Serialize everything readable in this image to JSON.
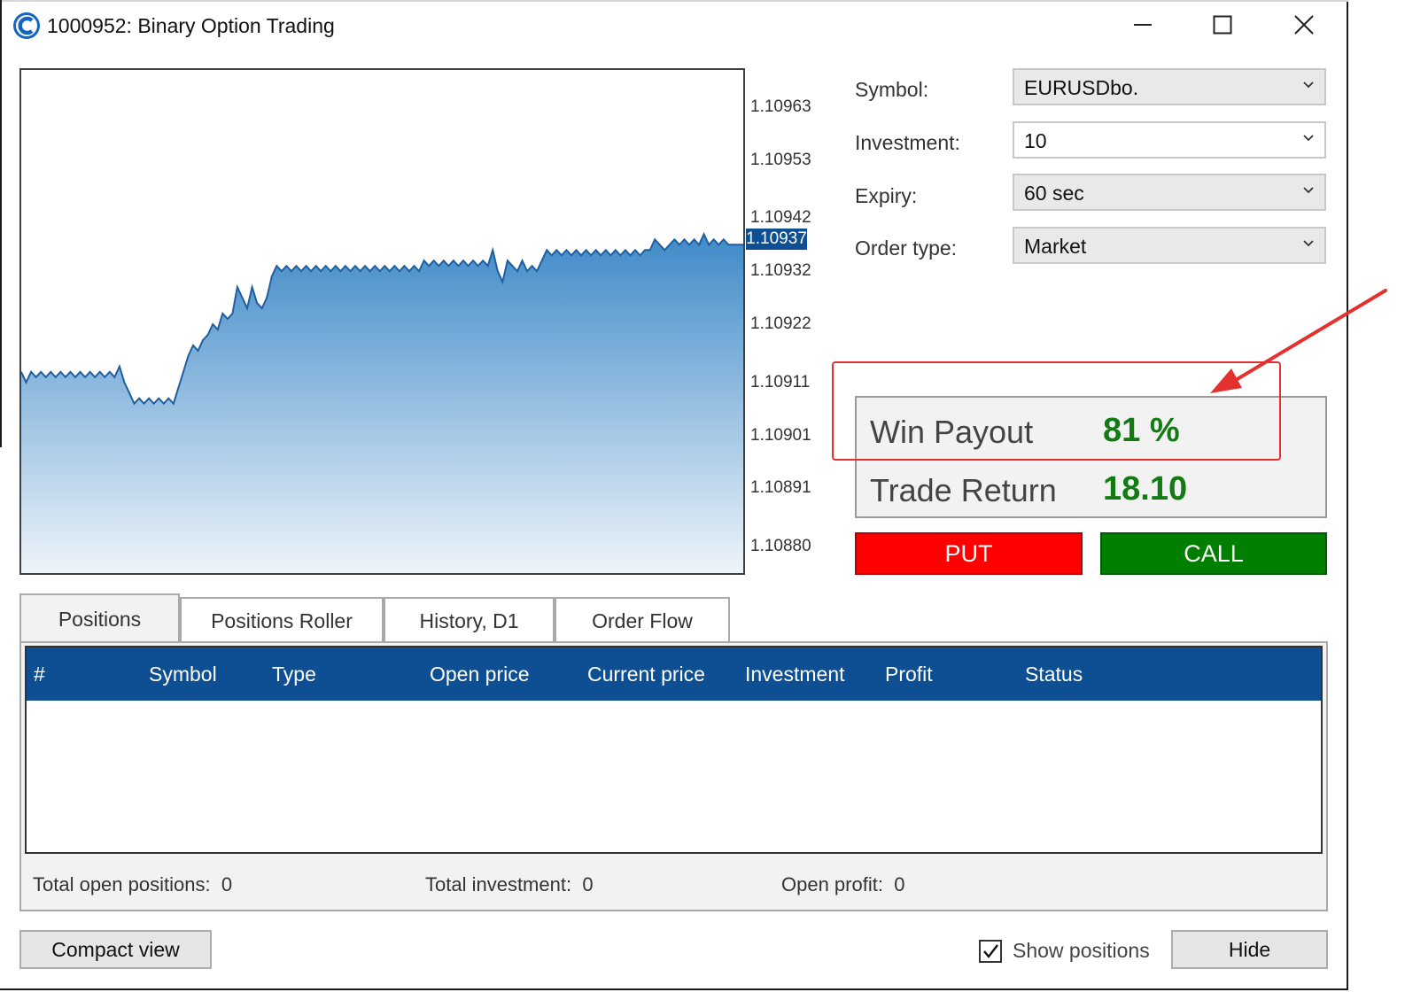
{
  "window": {
    "title": "1000952: Binary Option Trading"
  },
  "chart": {
    "price_ticks": [
      "1.10963",
      "1.10953",
      "1.10942",
      "1.10932",
      "1.10922",
      "1.10911",
      "1.10901",
      "1.10891",
      "1.10880"
    ],
    "current_price": "1.10937",
    "line_color": "#1f5fa0",
    "fill_top_color": "#3f8ac8",
    "fill_bottom_color": "#eef4fa"
  },
  "chart_data": {
    "type": "area",
    "title": "",
    "xlabel": "",
    "ylabel": "",
    "ylim": [
      1.10875,
      1.1097
    ],
    "current_value": 1.10937,
    "y": [
      1.10913,
      1.10911,
      1.10913,
      1.10912,
      1.10913,
      1.10912,
      1.10913,
      1.10912,
      1.10913,
      1.10912,
      1.10913,
      1.10912,
      1.10913,
      1.10912,
      1.10913,
      1.10912,
      1.10913,
      1.10912,
      1.10913,
      1.10912,
      1.10914,
      1.10911,
      1.10909,
      1.10907,
      1.10908,
      1.10907,
      1.10908,
      1.10907,
      1.10908,
      1.10907,
      1.10908,
      1.10907,
      1.1091,
      1.10913,
      1.10916,
      1.10918,
      1.10917,
      1.10919,
      1.1092,
      1.10922,
      1.10921,
      1.10924,
      1.10923,
      1.10924,
      1.10929,
      1.10927,
      1.10925,
      1.10929,
      1.10926,
      1.10925,
      1.10927,
      1.10931,
      1.10933,
      1.10932,
      1.10933,
      1.10932,
      1.10933,
      1.10932,
      1.10933,
      1.10932,
      1.10933,
      1.10932,
      1.10933,
      1.10932,
      1.10933,
      1.10932,
      1.10933,
      1.10932,
      1.10933,
      1.10932,
      1.10933,
      1.10932,
      1.10933,
      1.10932,
      1.10933,
      1.10932,
      1.10933,
      1.10932,
      1.10933,
      1.10932,
      1.10933,
      1.10932,
      1.10934,
      1.10933,
      1.10934,
      1.10933,
      1.10934,
      1.10933,
      1.10934,
      1.10933,
      1.10934,
      1.10933,
      1.10934,
      1.10933,
      1.10934,
      1.10933,
      1.10936,
      1.10932,
      1.1093,
      1.10934,
      1.10933,
      1.10932,
      1.10934,
      1.10932,
      1.10933,
      1.10932,
      1.10934,
      1.10936,
      1.10935,
      1.10936,
      1.10935,
      1.10936,
      1.10935,
      1.10936,
      1.10935,
      1.10936,
      1.10935,
      1.10936,
      1.10935,
      1.10936,
      1.10935,
      1.10936,
      1.10935,
      1.10936,
      1.10935,
      1.10936,
      1.10935,
      1.10936,
      1.10936,
      1.10938,
      1.10937,
      1.10936,
      1.10937,
      1.10938,
      1.10937,
      1.10938,
      1.10937,
      1.10938,
      1.10937,
      1.10939,
      1.10937,
      1.10938,
      1.10937,
      1.10938,
      1.10937,
      1.10937,
      1.10937,
      1.10937
    ]
  },
  "form": {
    "symbol_label": "Symbol:",
    "symbol_value": "EURUSDbo.",
    "investment_label": "Investment:",
    "investment_value": "10",
    "expiry_label": "Expiry:",
    "expiry_value": "60 sec",
    "order_type_label": "Order type:",
    "order_type_value": "Market"
  },
  "payout": {
    "win_label": "Win Payout",
    "win_value": "81 %",
    "return_label": "Trade Return",
    "return_value": "18.10",
    "value_color": "#137b13"
  },
  "actions": {
    "put_label": "PUT",
    "call_label": "CALL",
    "put_color": "#ff0000",
    "call_color": "#007e00"
  },
  "tabs": [
    {
      "label": "Positions",
      "active": true
    },
    {
      "label": "Positions Roller",
      "active": false
    },
    {
      "label": "History, D1",
      "active": false
    },
    {
      "label": "Order Flow",
      "active": false
    }
  ],
  "table": {
    "columns": [
      "#",
      "Symbol",
      "Type",
      "Open price",
      "Current price",
      "Investment",
      "Profit",
      "Status"
    ],
    "rows": [],
    "header_color": "#0e4f93"
  },
  "summary": {
    "total_open_label": "Total open positions:",
    "total_open_value": "0",
    "total_investment_label": "Total investment:",
    "total_investment_value": "0",
    "open_profit_label": "Open profit:",
    "open_profit_value": "0"
  },
  "footer": {
    "compact_label": "Compact view",
    "show_positions_label": "Show positions",
    "show_positions_checked": true,
    "hide_label": "Hide"
  },
  "icons": {
    "app": "app-logo-icon",
    "minimize": "minimize-icon",
    "maximize": "maximize-icon",
    "close": "close-icon",
    "dropdown": "chevron-down-icon",
    "checkbox": "checkmark-icon"
  }
}
